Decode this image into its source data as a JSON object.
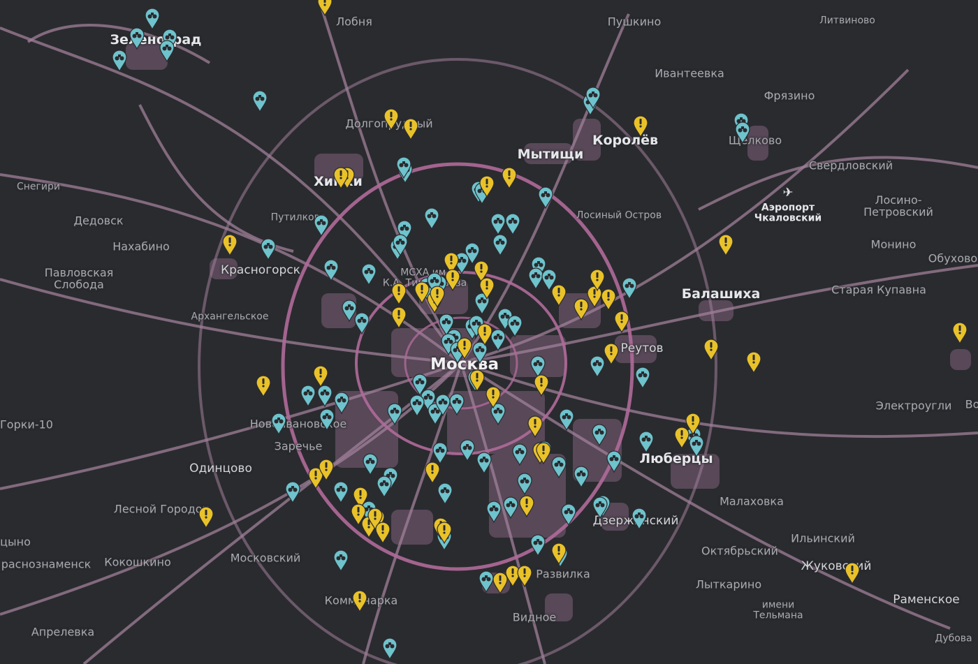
{
  "map": {
    "labels": [
      {
        "text": "Зеленоград",
        "kind": "big"
      },
      {
        "text": "Лобня",
        "kind": "normal"
      },
      {
        "text": "Пушкино",
        "kind": "normal"
      },
      {
        "text": "Литвиново",
        "kind": "small"
      },
      {
        "text": "Ивантеевка",
        "kind": "normal"
      },
      {
        "text": "Фрязино",
        "kind": "normal"
      },
      {
        "text": "Долгопрудный",
        "kind": "normal"
      },
      {
        "text": "Королёв",
        "kind": "big"
      },
      {
        "text": "Щёлково",
        "kind": "normal"
      },
      {
        "text": "Мытищи",
        "kind": "big"
      },
      {
        "text": "Свердловский",
        "kind": "normal"
      },
      {
        "text": "Химки",
        "kind": "big"
      },
      {
        "text": "Снегири",
        "kind": "small"
      },
      {
        "text": "Лосиный Остров",
        "kind": "small"
      },
      {
        "text": "Аэропорт\nЧкаловский",
        "kind": "airport"
      },
      {
        "text": "Лосино-\nПетровский",
        "kind": "normal"
      },
      {
        "text": "Дедовск",
        "kind": "normal"
      },
      {
        "text": "Путилково",
        "kind": "small"
      },
      {
        "text": "Нахабино",
        "kind": "normal"
      },
      {
        "text": "Монино",
        "kind": "normal"
      },
      {
        "text": "Обухово",
        "kind": "normal"
      },
      {
        "text": "Павловская\nСлобода",
        "kind": "normal"
      },
      {
        "text": "Красногорск",
        "kind": "med"
      },
      {
        "text": "МСХА им.\nК.А. Тимирязева",
        "kind": "small"
      },
      {
        "text": "Старая Купавна",
        "kind": "normal"
      },
      {
        "text": "Балашиха",
        "kind": "big"
      },
      {
        "text": "Архангельское",
        "kind": "small"
      },
      {
        "text": "Реутов",
        "kind": "med"
      },
      {
        "text": "Москва",
        "kind": "huge"
      },
      {
        "text": "Новоивановское",
        "kind": "normal"
      },
      {
        "text": "Горки-10",
        "kind": "normal"
      },
      {
        "text": "Электроугли",
        "kind": "normal"
      },
      {
        "text": "Во",
        "kind": "normal"
      },
      {
        "text": "Заречье",
        "kind": "normal"
      },
      {
        "text": "Одинцово",
        "kind": "med"
      },
      {
        "text": "Люберцы",
        "kind": "big"
      },
      {
        "text": "Лесной Городок",
        "kind": "normal"
      },
      {
        "text": "Малаховка",
        "kind": "normal"
      },
      {
        "text": "Дзержинский",
        "kind": "med"
      },
      {
        "text": "цыно",
        "kind": "normal"
      },
      {
        "text": "Ильинский",
        "kind": "normal"
      },
      {
        "text": "Октябрьский",
        "kind": "normal"
      },
      {
        "text": "Московский",
        "kind": "normal"
      },
      {
        "text": "раснознаменск",
        "kind": "normal"
      },
      {
        "text": "Кокошкино",
        "kind": "normal"
      },
      {
        "text": "Жуковский",
        "kind": "med"
      },
      {
        "text": "Развилка",
        "kind": "normal"
      },
      {
        "text": "Лыткарино",
        "kind": "normal"
      },
      {
        "text": "Коммунарка",
        "kind": "normal"
      },
      {
        "text": "Раменское",
        "kind": "med"
      },
      {
        "text": "имени\nТельмана",
        "kind": "small"
      },
      {
        "text": "Видное",
        "kind": "normal"
      },
      {
        "text": "Апрелевка",
        "kind": "normal"
      },
      {
        "text": "Дубова",
        "kind": "small"
      }
    ],
    "colors": {
      "background": "#2a2b2f",
      "roads": "#a0809a",
      "major_roads": "#b06a9a",
      "urban": "#7d607a",
      "teal_pin": "#6ec3cc",
      "yellow_pin": "#e9c229",
      "label": "#a9abb0"
    },
    "marker_icons": {
      "teal": "binoculars-icon",
      "yellow": "exclamation-icon"
    },
    "airport_icon": "airplane-icon"
  }
}
